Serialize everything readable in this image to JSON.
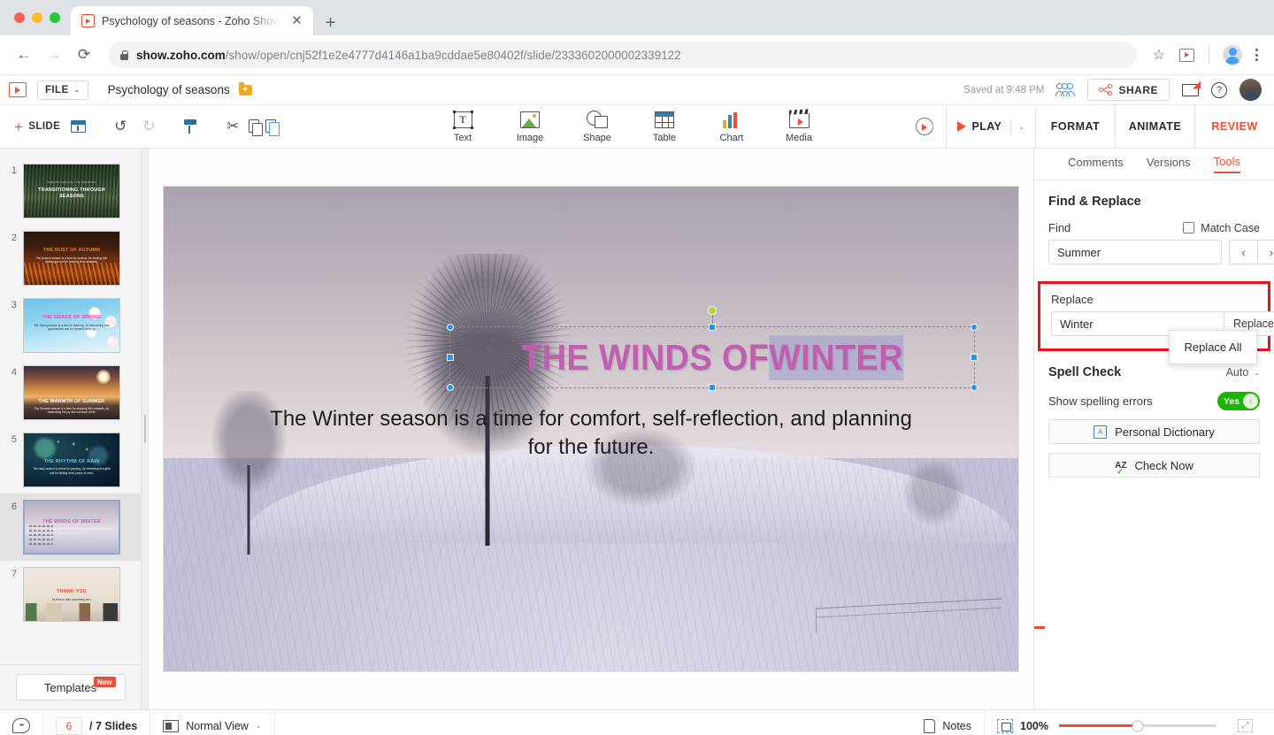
{
  "browser": {
    "tab_title": "Psychology of seasons - Zoho Show",
    "tab_close_label": "✕",
    "newtab_label": "+",
    "back_label": "←",
    "forward_label": "→",
    "reload_label": "⟳",
    "url_domain": "show.zoho.com",
    "url_path": "/show/open/cnj52f1e2e4777d4146a1ba9cddae5e80402f/slide/2333602000002339122",
    "star_label": "☆"
  },
  "app_header": {
    "file_label": "FILE",
    "file_caret": "⌄",
    "doc_title": "Psychology of seasons",
    "saved_status": "Saved at 9:48 PM",
    "share_label": "SHARE",
    "help_label": "?"
  },
  "ribbon": {
    "add_slide_label": "SLIDE",
    "plus_label": "+",
    "undo_label": "↺",
    "redo_label": "↻",
    "scissors_label": "✂",
    "insert_tools": [
      {
        "label": "Text",
        "icon": "text-icon"
      },
      {
        "label": "Image",
        "icon": "image-icon"
      },
      {
        "label": "Shape",
        "icon": "shape-icon"
      },
      {
        "label": "Table",
        "icon": "table-icon"
      },
      {
        "label": "Chart",
        "icon": "chart-icon"
      },
      {
        "label": "Media",
        "icon": "media-icon"
      }
    ],
    "play_label": "PLAY",
    "play_caret": "⌄",
    "tabs": [
      {
        "label": "FORMAT",
        "active": false
      },
      {
        "label": "ANIMATE",
        "active": false
      },
      {
        "label": "REVIEW",
        "active": true
      }
    ]
  },
  "slide_panel": {
    "slides": [
      {
        "num": "1",
        "title": "TRANSITIONING THROUGH SEASONS",
        "eyebrow": "THE PSYCHOLOGY OF SEASONS",
        "subtitle": "",
        "bg": "bg1",
        "title_color": "#ffffff",
        "title_top": "44%",
        "sub_top": "0",
        "active": false
      },
      {
        "num": "2",
        "title": "THE RUST OF AUTUMN",
        "eyebrow": "",
        "subtitle": "The Autumn season is a time for survival, for dealing with challenges and for learning from mistakes.",
        "bg": "bg2",
        "title_color": "#f0812c",
        "title_top": "30%",
        "sub_top": "46%",
        "active": false
      },
      {
        "num": "3",
        "title": "THE GRACE OF SPRING",
        "eyebrow": "",
        "subtitle": "The Spring season is a time for learning, for discovering new opportunities and for dynamic thinking.",
        "bg": "bg3",
        "title_color": "#ff3fa4",
        "title_top": "30%",
        "sub_top": "46%",
        "active": false
      },
      {
        "num": "4",
        "title": "THE WARMTH OF SUMMER",
        "eyebrow": "",
        "subtitle": "The Summer season is a time for enjoying life's rewards, for celebrating the joy and romance of life.",
        "bg": "bg4",
        "title_color": "#ffffff",
        "title_top": "62%",
        "sub_top": "76%",
        "active": false
      },
      {
        "num": "5",
        "title": "THE RHYTHM OF RAIN",
        "eyebrow": "",
        "subtitle": "The rainy season is a time for pausing, for refreshing thoughts and for finding inner peace of mind.",
        "bg": "bg5",
        "title_color": "#4fd0ff",
        "title_top": "48%",
        "sub_top": "64%",
        "active": false
      },
      {
        "num": "6",
        "title": "THE WINDS OF WINTER",
        "eyebrow": "",
        "subtitle": "The Winter season is a time for comfort, self-reflection, and planning for the future.",
        "bg": "bg6",
        "title_color": "#bf5fb0",
        "title_top": "34%",
        "sub_top": "50%",
        "active": true
      },
      {
        "num": "7",
        "title": "THANK YOU",
        "eyebrow": "",
        "subtitle": "It's time to start something new.",
        "bg": "bg7",
        "title_color": "#e04a2f",
        "title_top": "40%",
        "sub_top": "56%",
        "active": false
      }
    ],
    "templates_label": "Templates",
    "templates_badge": "New"
  },
  "slide": {
    "title_before": "THE WINDS OF ",
    "title_selected_word": "WINTER",
    "title_color": "#bf5fb0",
    "subtitle": "The Winter season is a time for comfort, self-reflection, and planning for the future.",
    "selection_handle_color": "#2196f3",
    "rotate_handle_color": "#b5d33c"
  },
  "right_panel": {
    "tabs": [
      {
        "label": "Comments",
        "active": false
      },
      {
        "label": "Versions",
        "active": false
      },
      {
        "label": "Tools",
        "active": true
      }
    ],
    "find_replace": {
      "section_title": "Find & Replace",
      "find_label": "Find",
      "find_value": "Summer",
      "find_placeholder": "Find",
      "match_case_label": "Match Case",
      "prev_label": "‹",
      "next_label": "›",
      "replace_label": "Replace",
      "replace_value": "Winter",
      "replace_placeholder": "Replace",
      "replace_button_label": "Replace",
      "replace_caret": "⌄",
      "replace_all_label": "Replace All",
      "highlight_color": "#e8141a"
    },
    "spell_check": {
      "section_title": "Spell Check",
      "mode_label": "Auto",
      "mode_caret": "⌄",
      "show_errors_label": "Show spelling errors",
      "toggle_state": "Yes",
      "personal_dictionary_label": "Personal Dictionary",
      "check_now_label": "Check Now",
      "toggle_on_color": "#1ab700"
    }
  },
  "status_bar": {
    "current_slide": "6",
    "slide_count_label": "/ 7 Slides",
    "view_label": "Normal View",
    "view_caret": "⌄",
    "notes_label": "Notes",
    "zoom_level": "100%"
  }
}
